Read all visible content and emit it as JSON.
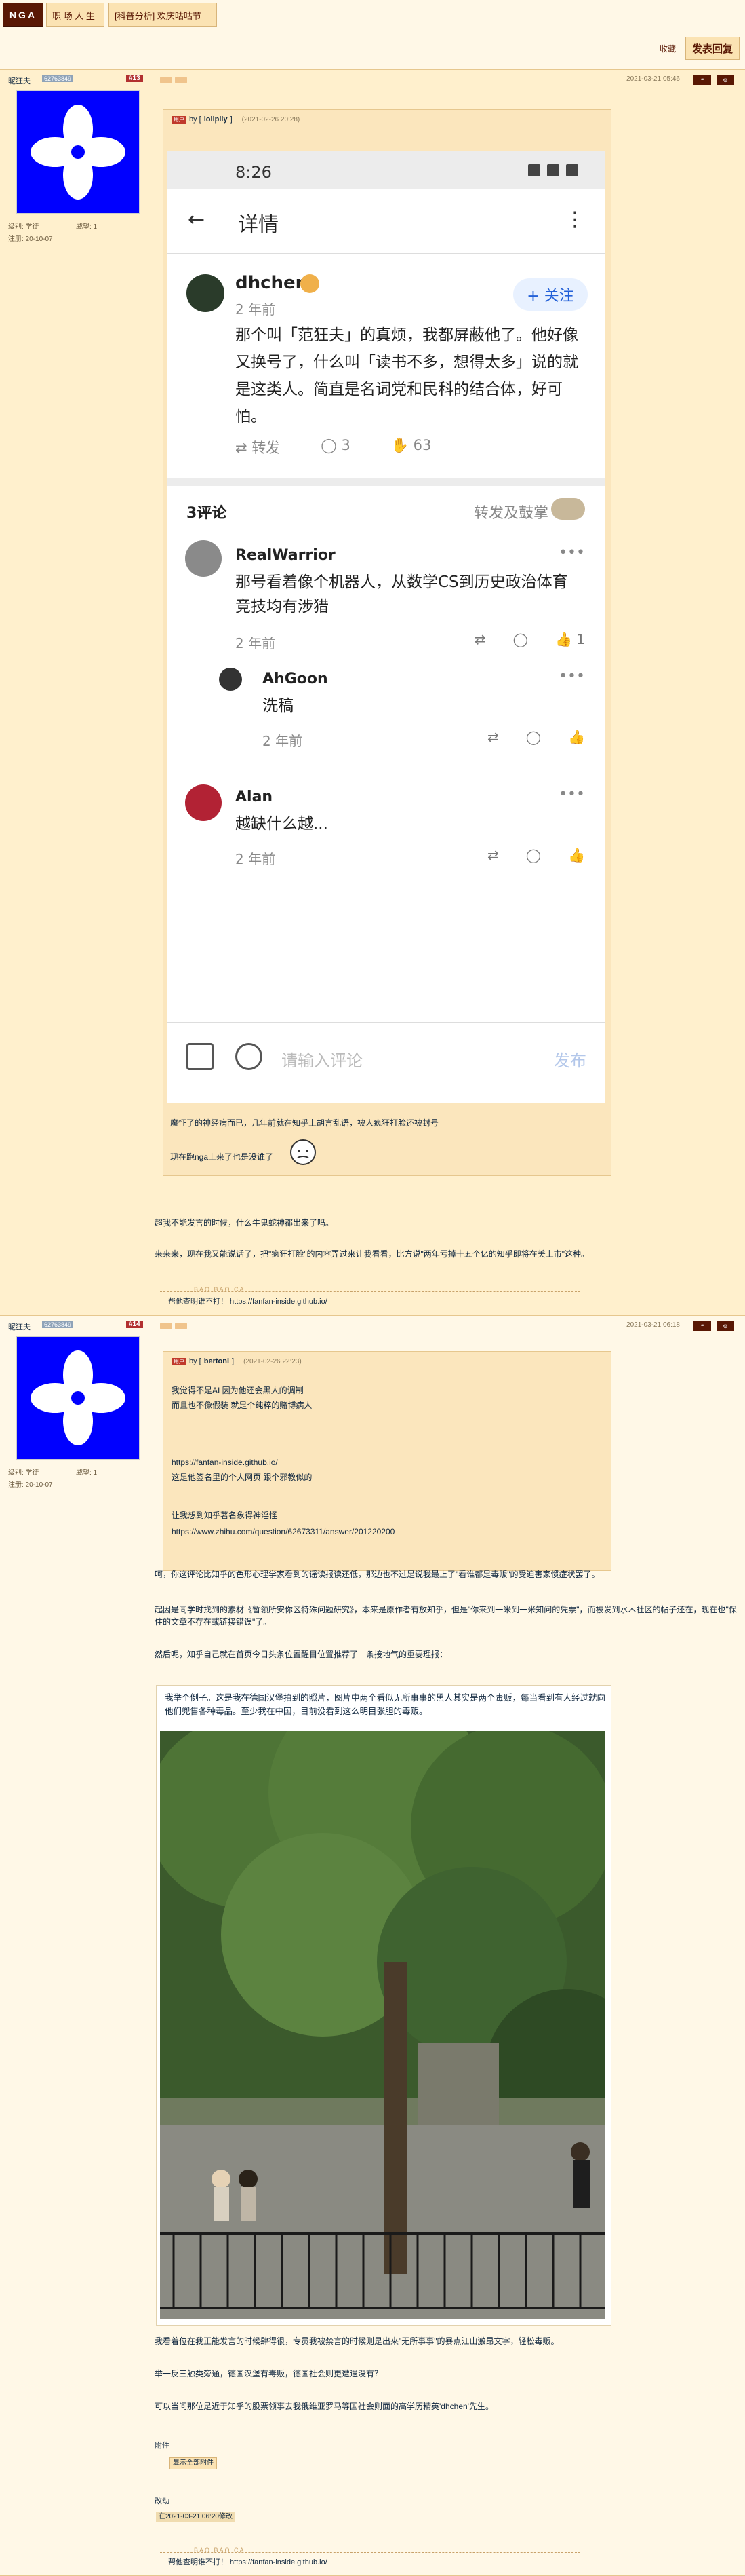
{
  "header": {
    "logo": "NGA",
    "crumb1": "职 场 人 生",
    "crumb2": "[科普分析] 欢庆咕咕节"
  },
  "actions": {
    "favorite": "收藏",
    "reply": "发表回复"
  },
  "post1": {
    "username": "昵狂夫",
    "uid": "62763849",
    "floor": "#13",
    "stats": [
      "级别: 学徒",
      "威望: 1",
      "注册: 20-10-07"
    ],
    "date": "2021-03-21 05:46",
    "quote": {
      "tag": "用户",
      "by": "by [",
      "user": "lolipily",
      "date": "(2021-02-26 20:28)"
    },
    "phone": {
      "time": "8:26",
      "nav_title": "详情",
      "back": "←",
      "more": "⋮",
      "author": "dhchen",
      "time_ago": "2 年前",
      "follow": "+ 关注",
      "body": "那个叫「范狂夫」的真烦，我都屏蔽他了。他好像又换号了，什么叫「读书不多，想得太多」说的就是这类人。简直是名词党和民科的结合体，好可怕。",
      "repost": "转发",
      "comments_count": "3",
      "likes_count": "63",
      "comments_header": "3评论",
      "repost_like": "转发及鼓掌",
      "comments": [
        {
          "name": "RealWarrior",
          "text": "那号看着像个机器人，从数学CS到历史政治体育竞技均有涉猎",
          "time": "2 年前",
          "likes": "1"
        },
        {
          "name": "AhGoon",
          "text": "洗稿",
          "time": "2 年前",
          "likes": ""
        },
        {
          "name": "Alan",
          "text": "越缺什么越...",
          "time": "2 年前",
          "likes": ""
        }
      ],
      "input_placeholder": "请输入评论",
      "send": "发布"
    },
    "caption1": "魔怔了的神经病而已，几年前就在知乎上胡言乱语，被人疯狂打脸还被封号",
    "caption2": "现在跑nga上来了也是没谁了",
    "text1": "超我不能发言的时候，什么牛鬼蛇神都出来了吗。",
    "text2": "来来来，现在我又能说话了，把\"疯狂打脸\"的内容弄过来让我看看，比方说\"两年亏掉十五个亿的知乎即将在美上市\"这种。",
    "sig_label": "BAO BAO CA",
    "sig": "帮他查明谁不打！ https://fanfan-inside.github.io/"
  },
  "post2": {
    "username": "昵狂夫",
    "uid": "62763849",
    "floor": "#14",
    "stats": [
      "级别: 学徒",
      "威望: 1",
      "注册: 20-10-07"
    ],
    "date": "2021-03-21 06:18",
    "quote": {
      "tag": "用户",
      "by": "by [",
      "user": "bertoni",
      "date": "(2021-02-26 22:23)"
    },
    "quote_lines": [
      "我觉得不是AI 因为他还会黑人的调制",
      "而且也不像假装 就是个纯粹的赌博病人",
      "",
      "",
      "https://fanfan-inside.github.io/",
      "这是他签名里的个人网页 跟个邪教似的",
      "",
      "让我想到知乎著名象得神淫怪",
      "https://www.zhihu.com/question/62673311/answer/201220200"
    ],
    "texts": [
      "呵，你这评论比知乎的色形心理学家看到的谣读报读还低，那边也不过是说我最上了\"看谁都是毒贩\"的受迫害家惯症状罢了。",
      "起因是同学时找到的素材《暂领所安你区特殊问题研究》，本来是原作者有放知乎，但是\"你来到一米到一米知问的凭票\"，而被发到水木社区的帖子还在，现在也\"保住的文章不存在或链接错误\"了。",
      "然后呢，知乎自己就在首页今日头条位置醒目位置推荐了一条接地气的重要理报："
    ],
    "photo_caption": "我举个例子。这是我在德国汉堡拍到的照片，图片中两个看似无所事事的黑人其实是两个毒贩，每当看到有人经过就向他们兜售各种毒品。至少我在中国，目前没看到这么明目张胆的毒贩。",
    "texts2": [
      "我看着位在我正能发言的时候肆得很，专员我被禁言的时候则是出来\"无所事事\"的暴点江山激昂文字，轻松毒贩。",
      "举一反三触类旁通，德国汉堡有毒贩，德国社会则更遭遇没有？",
      "可以当问那位是近于知乎的股票领事去我俄维亚罗马等国社会则面的高学历精英'dhchen'先生。"
    ],
    "attach_label": "附件",
    "attach_btn": "显示全部附件",
    "edit_label": "改动",
    "edit_text": "在2021-03-21 06:20修改",
    "sig_label": "BAO BAO CA",
    "sig": "帮他查明谁不打！ https://fanfan-inside.github.io/"
  },
  "colors": {
    "bg": "#fff8e7",
    "post_bg": "#fff0cd",
    "brand": "#591804",
    "avatar_blue": "#0000ff"
  }
}
